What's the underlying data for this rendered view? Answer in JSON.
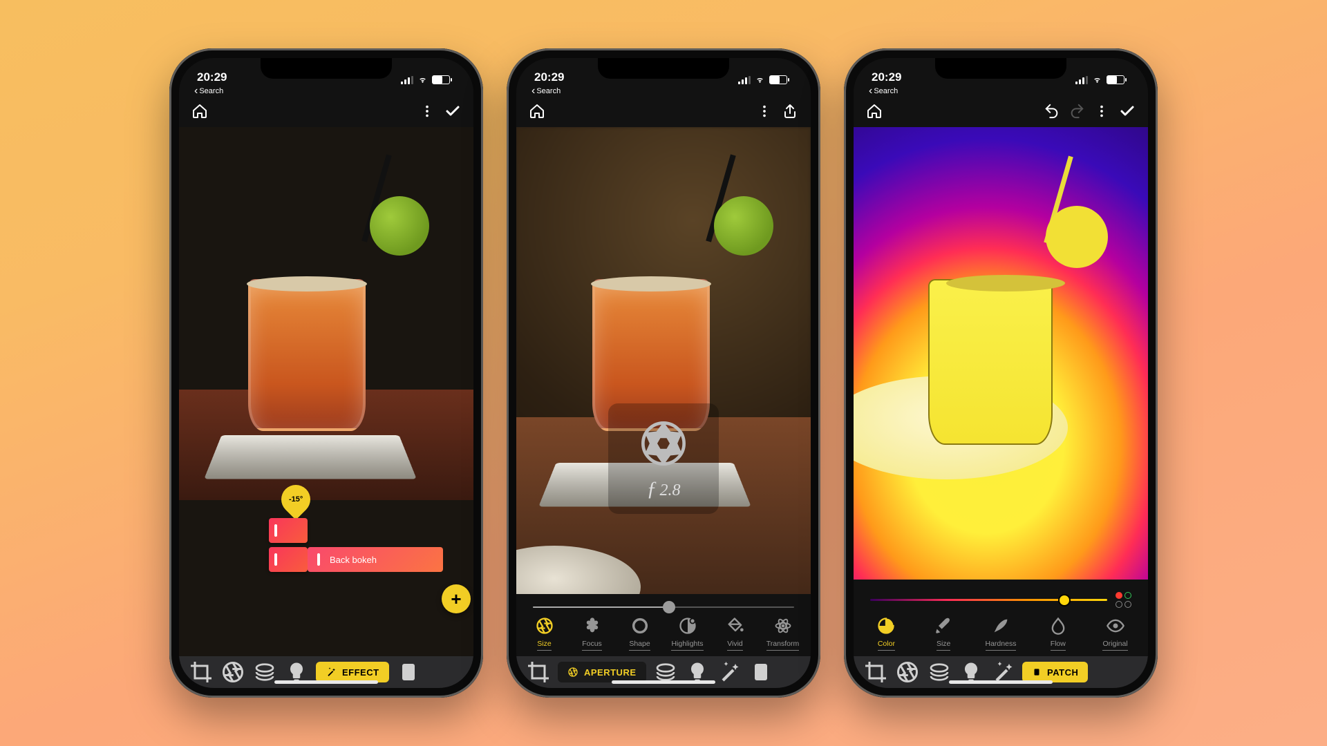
{
  "status": {
    "time": "20:29",
    "back": "Search"
  },
  "angle_value": "-15°",
  "effect_label": "Back bokeh",
  "aperture_value": "2.8",
  "bottom_pills": {
    "effect": "EFFECT",
    "aperture": "APERTURE",
    "patch": "PATCH"
  },
  "fab": "+",
  "phone2_tools": [
    {
      "key": "size",
      "label": "Size",
      "active": true
    },
    {
      "key": "focus",
      "label": "Focus"
    },
    {
      "key": "shape",
      "label": "Shape"
    },
    {
      "key": "highlights",
      "label": "Highlights"
    },
    {
      "key": "vivid",
      "label": "Vivid"
    },
    {
      "key": "transform",
      "label": "Transform"
    }
  ],
  "phone3_tools": [
    {
      "key": "color",
      "label": "Color",
      "active": true
    },
    {
      "key": "size",
      "label": "Size"
    },
    {
      "key": "hardness",
      "label": "Hardness"
    },
    {
      "key": "flow",
      "label": "Flow"
    },
    {
      "key": "original",
      "label": "Original"
    }
  ],
  "slider2_percent": 52,
  "slider3_percent": 82
}
